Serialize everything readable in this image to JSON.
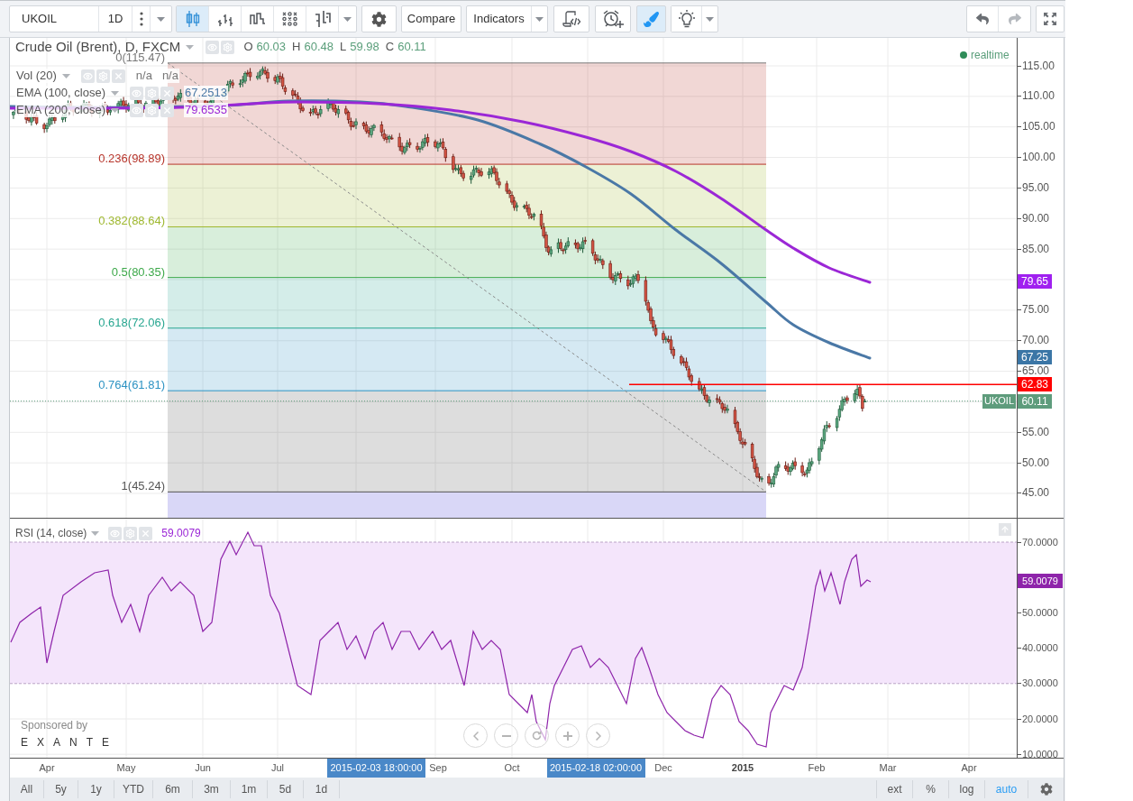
{
  "toolbar": {
    "symbol": "UKOIL",
    "interval": "1D",
    "chart_styles": [
      {
        "kind": "candles",
        "selected": true
      },
      {
        "kind": "bars",
        "selected": false
      },
      {
        "kind": "line-break",
        "selected": false
      },
      {
        "kind": "point-figure",
        "selected": false
      },
      {
        "kind": "kagi",
        "selected": false
      }
    ],
    "compare": "Compare",
    "indicators": "Indicators",
    "tools": [
      {
        "kind": "script",
        "selected": false
      },
      {
        "kind": "alert",
        "selected": false
      },
      {
        "kind": "brush",
        "selected": true
      },
      {
        "kind": "idea",
        "selected": false
      }
    ],
    "history": [
      {
        "kind": "undo",
        "disabled": false
      },
      {
        "kind": "redo",
        "disabled": true
      }
    ]
  },
  "legend": {
    "title": "Crude Oil (Brent), D, FXCM",
    "ohlc": [
      {
        "label": "O",
        "value": "60.03"
      },
      {
        "label": "H",
        "value": "60.48"
      },
      {
        "label": "L",
        "value": "59.98"
      },
      {
        "label": "C",
        "value": "60.11"
      }
    ],
    "studies": [
      {
        "name": "Vol (20)",
        "values": [
          "n/a",
          "n/a"
        ]
      },
      {
        "name": "EMA (100, close)",
        "values": [
          "67.2513"
        ],
        "color": "#4a78a6"
      },
      {
        "name": "EMA (200, close)",
        "values": [
          "79.6535"
        ],
        "color": "#9b27d6"
      }
    ]
  },
  "status": "realtime",
  "fibonacci": [
    {
      "label": "0(115.47)",
      "color": "#787878"
    },
    {
      "label": "0.236(98.89)",
      "color": "#b7352b"
    },
    {
      "label": "0.382(88.64)",
      "color": "#9fb82f"
    },
    {
      "label": "0.5(80.35)",
      "color": "#3ea94b"
    },
    {
      "label": "0.618(72.06)",
      "color": "#27a690"
    },
    {
      "label": "0.764(61.81)",
      "color": "#2e93c3"
    },
    {
      "label": "1(45.24)",
      "color": "#555555"
    }
  ],
  "price_axis": [
    "115.00",
    "110.00",
    "105.00",
    "100.00",
    "95.00",
    "90.00",
    "85.00",
    "75.00",
    "70.00",
    "65.00",
    "55.00",
    "50.00",
    "45.00"
  ],
  "price_tags": [
    {
      "label": "79.65",
      "color": "#a020f0"
    },
    {
      "label": "67.25",
      "color": "#3b76a6"
    },
    {
      "label": "62.83",
      "color": "#ff0000"
    },
    {
      "label": "60.11",
      "symbol": "UKOIL",
      "color": "#5e9c7c"
    }
  ],
  "rsi": {
    "name": "RSI (14, close)",
    "value": "59.0079",
    "axis": [
      "70.0000",
      "50.0000",
      "40.0000",
      "30.0000",
      "20.0000",
      "10.0000"
    ],
    "tag": "59.0079"
  },
  "sponsor": {
    "caption": "Sponsored by",
    "brand": "EXANTE"
  },
  "time_axis": [
    {
      "kind": "month",
      "label": "Apr"
    },
    {
      "kind": "month",
      "label": "May"
    },
    {
      "kind": "month",
      "label": "Jun"
    },
    {
      "kind": "month",
      "label": "Jul"
    },
    {
      "kind": "crosshair",
      "label": "2015-02-03 18:00:00"
    },
    {
      "kind": "month",
      "label": "Sep"
    },
    {
      "kind": "month",
      "label": "Oct"
    },
    {
      "kind": "crosshair",
      "label": "2015-02-18 02:00:00"
    },
    {
      "kind": "month",
      "label": "Dec"
    },
    {
      "kind": "year",
      "label": "2015"
    },
    {
      "kind": "month",
      "label": "Feb"
    },
    {
      "kind": "month",
      "label": "Mar"
    },
    {
      "kind": "month",
      "label": "Apr"
    }
  ],
  "bottom_bar": {
    "ranges": [
      "All",
      "5y",
      "1y",
      "YTD",
      "6m",
      "3m",
      "1m",
      "5d",
      "1d"
    ],
    "options": [
      {
        "label": "ext",
        "selected": false
      },
      {
        "label": "%",
        "selected": false
      },
      {
        "label": "log",
        "selected": false
      },
      {
        "label": "auto",
        "selected": true
      }
    ]
  }
}
